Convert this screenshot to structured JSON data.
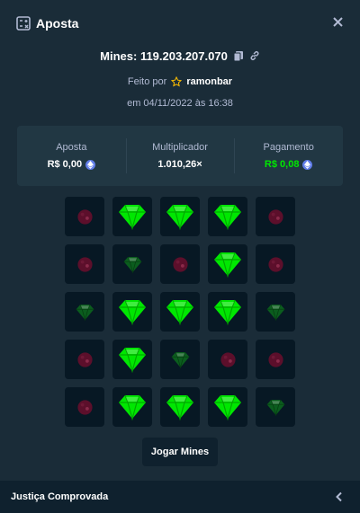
{
  "header": {
    "title": "Aposta",
    "icon": "ticket-icon",
    "close_icon": "close-icon"
  },
  "game": {
    "title": "Mines: 119.203.207.070",
    "copy_icon": "copy-icon",
    "link_icon": "link-icon"
  },
  "author": {
    "prefix": "Feito por",
    "name": "ramonbar",
    "star_icon": "star-icon"
  },
  "date": "em 04/11/2022 às 16:38",
  "stats": {
    "bet_label": "Aposta",
    "bet_value": "R$ 0,00",
    "multiplier_label": "Multiplicador",
    "multiplier_value": "1.010,26×",
    "payout_label": "Pagamento",
    "payout_value": "R$ 0,08"
  },
  "colors": {
    "payout": "#00e701",
    "gem_bright": "#00e701",
    "gem_dim": "#0b5d1e",
    "mine": "#5c0f2b",
    "coin": "#627eea"
  },
  "board": {
    "rows": [
      [
        "mine",
        "gem",
        "gem",
        "gem",
        "mine"
      ],
      [
        "mine",
        "gem-dim",
        "mine",
        "gem",
        "mine"
      ],
      [
        "gem-dim",
        "gem",
        "gem",
        "gem",
        "gem-dim"
      ],
      [
        "mine",
        "gem",
        "gem-dim",
        "mine",
        "mine"
      ],
      [
        "mine",
        "gem",
        "gem",
        "gem",
        "gem-dim"
      ]
    ]
  },
  "actions": {
    "play_label": "Jogar Mines"
  },
  "footer": {
    "label": "Justiça Comprovada",
    "chevron_icon": "chevron-left-icon"
  }
}
